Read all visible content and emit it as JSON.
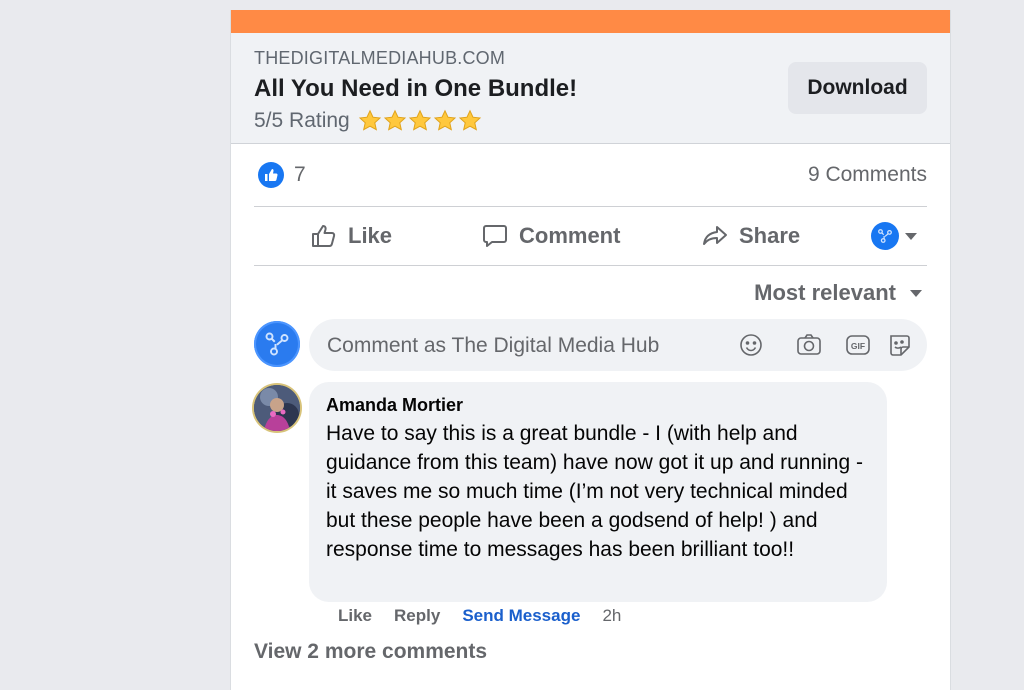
{
  "link_preview": {
    "domain": "THEDIGITALMEDIAHUB.COM",
    "headline": "All You Need in One Bundle!",
    "rating_text": "5/5 Rating",
    "star_count": 5,
    "download_label": "Download"
  },
  "reactions": {
    "like_count": "7",
    "comments_count": "9 Comments"
  },
  "actions": {
    "like": "Like",
    "comment": "Comment",
    "share": "Share"
  },
  "sort_label": "Most relevant",
  "composer": {
    "placeholder": "Comment as The Digital Media Hub",
    "icons": [
      "emoji-icon",
      "camera-icon",
      "gif-icon",
      "sticker-icon"
    ]
  },
  "comments": [
    {
      "author": "Amanda Mortier",
      "text": "Have to say this is a great bundle - I (with help and guidance from this team) have now got it up and running - it saves me so much time (I’m not very technical minded but these people have been a godsend of help! ) and response time to messages has been brilliant too!!",
      "actions": {
        "like": "Like",
        "reply": "Reply",
        "send_message": "Send Message",
        "time": "2h"
      }
    }
  ],
  "view_more": "View 2 more comments",
  "colors": {
    "accent_bar": "#ff8a45",
    "brand_blue": "#1877f2",
    "send_message_link": "#1a5fcc",
    "star_yellow": "#ffc83d"
  }
}
